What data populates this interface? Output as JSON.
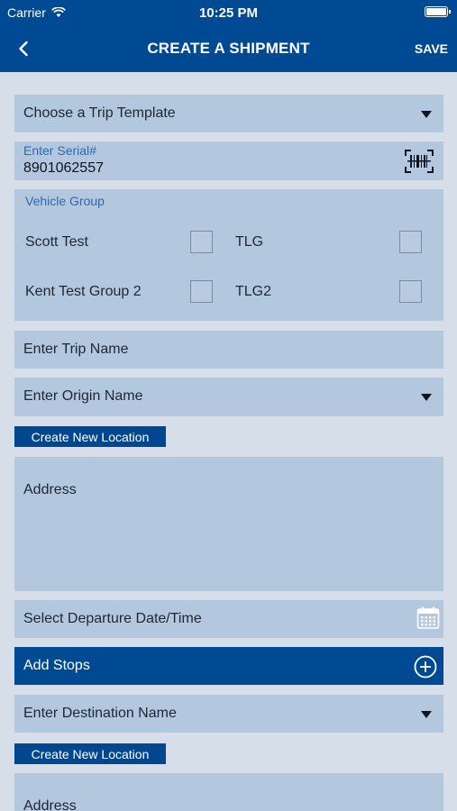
{
  "status_bar": {
    "carrier": "Carrier",
    "time": "10:25 PM"
  },
  "nav": {
    "back_icon": "chevron-left-icon",
    "title": "CREATE A SHIPMENT",
    "save_label": "SAVE"
  },
  "trip_template": {
    "label": "Choose a Trip Template"
  },
  "serial": {
    "label": "Enter Serial#",
    "value": "8901062557",
    "scan_icon": "barcode-scan-icon"
  },
  "vehicle_group": {
    "label": "Vehicle Group",
    "items": [
      {
        "label": "Scott Test",
        "checked": false
      },
      {
        "label": "TLG",
        "checked": false
      },
      {
        "label": "Kent Test Group 2",
        "checked": false
      },
      {
        "label": "TLG2",
        "checked": false
      }
    ]
  },
  "trip_name": {
    "placeholder": "Enter Trip Name"
  },
  "origin": {
    "placeholder": "Enter Origin Name",
    "create_location_label": "Create New Location",
    "address_placeholder": "Address"
  },
  "departure": {
    "placeholder": "Select Departure Date/Time",
    "calendar_icon": "calendar-icon"
  },
  "stops": {
    "label": "Add Stops",
    "add_icon": "plus-circle-icon"
  },
  "destination": {
    "placeholder": "Enter Destination Name",
    "create_location_label": "Create New Location",
    "address_placeholder": "Address"
  },
  "colors": {
    "primary": "#004a93",
    "field_bg": "#b3c7de",
    "page_bg": "#d6dfe9",
    "accent_text": "#2a6bb0"
  }
}
